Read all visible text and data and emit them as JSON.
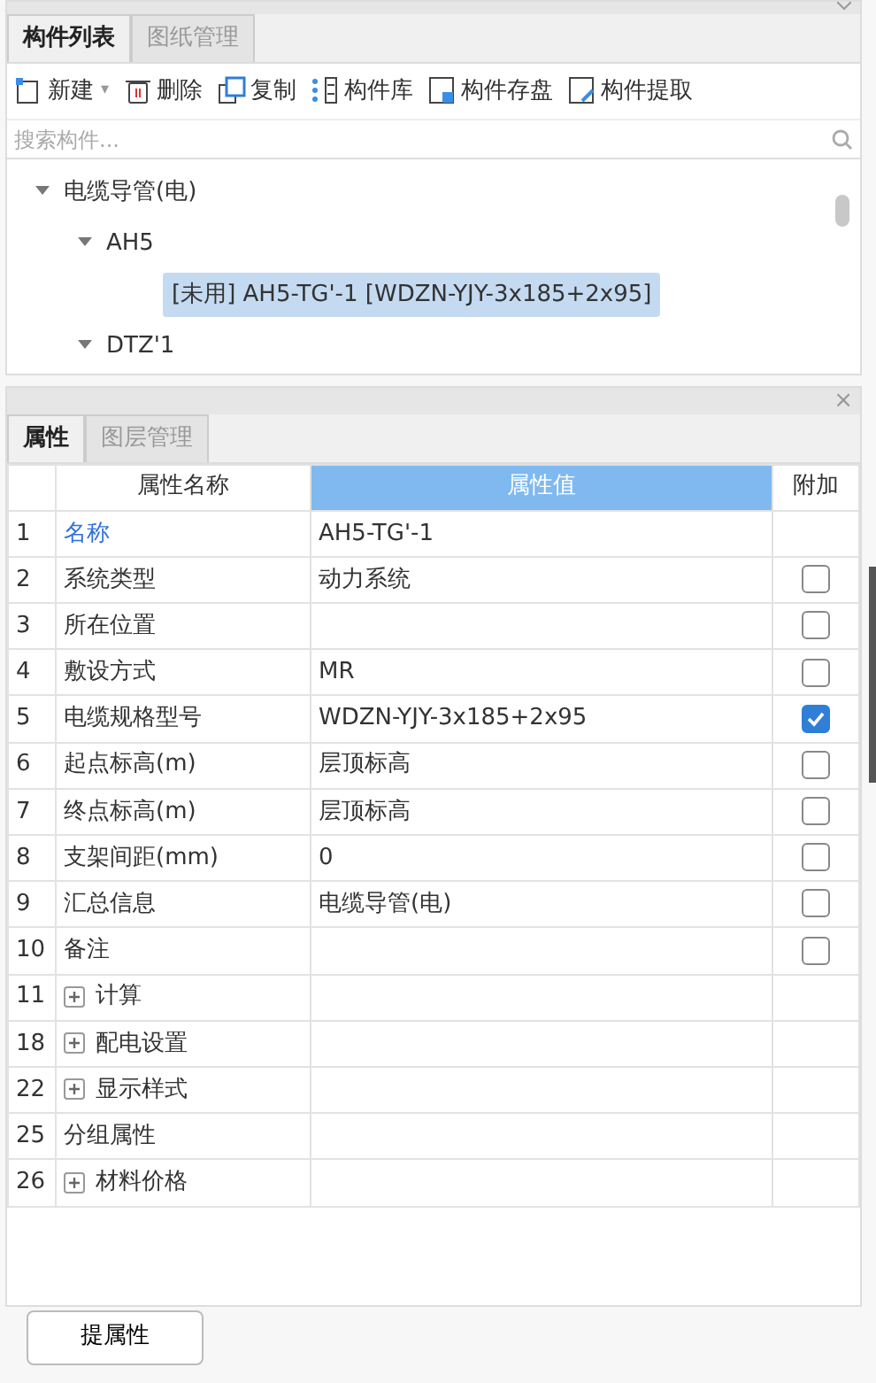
{
  "top_panel": {
    "tabs": [
      {
        "label": "构件列表",
        "selected": true
      },
      {
        "label": "图纸管理",
        "selected": false
      }
    ],
    "toolbar": [
      {
        "kind": "new",
        "label": "新建",
        "caret": "▾"
      },
      {
        "kind": "delete",
        "label": "删除"
      },
      {
        "kind": "copy",
        "label": "复制"
      },
      {
        "kind": "library",
        "label": "构件库"
      },
      {
        "kind": "save",
        "label": "构件存盘"
      },
      {
        "kind": "extract",
        "label": "构件提取"
      }
    ],
    "search": {
      "placeholder": "搜索构件..."
    },
    "tree": [
      {
        "label": "电缆导管(电)",
        "expanded": true,
        "children": [
          {
            "label": "AH5",
            "expanded": true,
            "children": [
              {
                "label": "[未用] AH5-TG'-1 [WDZN-YJY-3x185+2x95]",
                "selected": true
              }
            ]
          },
          {
            "label": "DTZ'1",
            "expanded": true
          }
        ]
      }
    ]
  },
  "bottom_panel": {
    "close": "×",
    "tabs": [
      {
        "label": "属性",
        "selected": true
      },
      {
        "label": "图层管理",
        "selected": false
      }
    ],
    "columns": [
      "属性名称",
      "属性值",
      "附加"
    ],
    "rows": [
      {
        "kind": "link",
        "number": "1",
        "name": "名称",
        "value": "AH5-TG'-1"
      },
      {
        "kind": "field",
        "number": "2",
        "name": "系统类型",
        "value": "动力系统",
        "checked": false
      },
      {
        "kind": "field",
        "number": "3",
        "name": "所在位置",
        "checked": false
      },
      {
        "kind": "field",
        "number": "4",
        "name": "敷设方式",
        "value": "MR",
        "checked": false
      },
      {
        "kind": "field",
        "number": "5",
        "name": "电缆规格型号",
        "value": "WDZN-YJY-3x185+2x95",
        "checked": true
      },
      {
        "kind": "field",
        "number": "6",
        "name": "起点标高(m)",
        "value": "层顶标高",
        "checked": false
      },
      {
        "kind": "field",
        "number": "7",
        "name": "终点标高(m)",
        "value": "层顶标高",
        "checked": false
      },
      {
        "kind": "field",
        "number": "8",
        "name": "支架间距(mm)",
        "value": "0",
        "checked": false
      },
      {
        "kind": "field",
        "number": "9",
        "name": "汇总信息",
        "value": "电缆导管(电)",
        "checked": false
      },
      {
        "kind": "field",
        "number": "10",
        "name": "备注",
        "checked": false
      },
      {
        "kind": "group",
        "number": "11",
        "name": "计算"
      },
      {
        "kind": "group",
        "number": "18",
        "name": "配电设置"
      },
      {
        "kind": "group",
        "number": "22",
        "name": "显示样式"
      },
      {
        "kind": "plain",
        "number": "25",
        "name": "分组属性"
      },
      {
        "kind": "group",
        "number": "26",
        "name": "材料价格"
      }
    ],
    "button": "提属性"
  }
}
